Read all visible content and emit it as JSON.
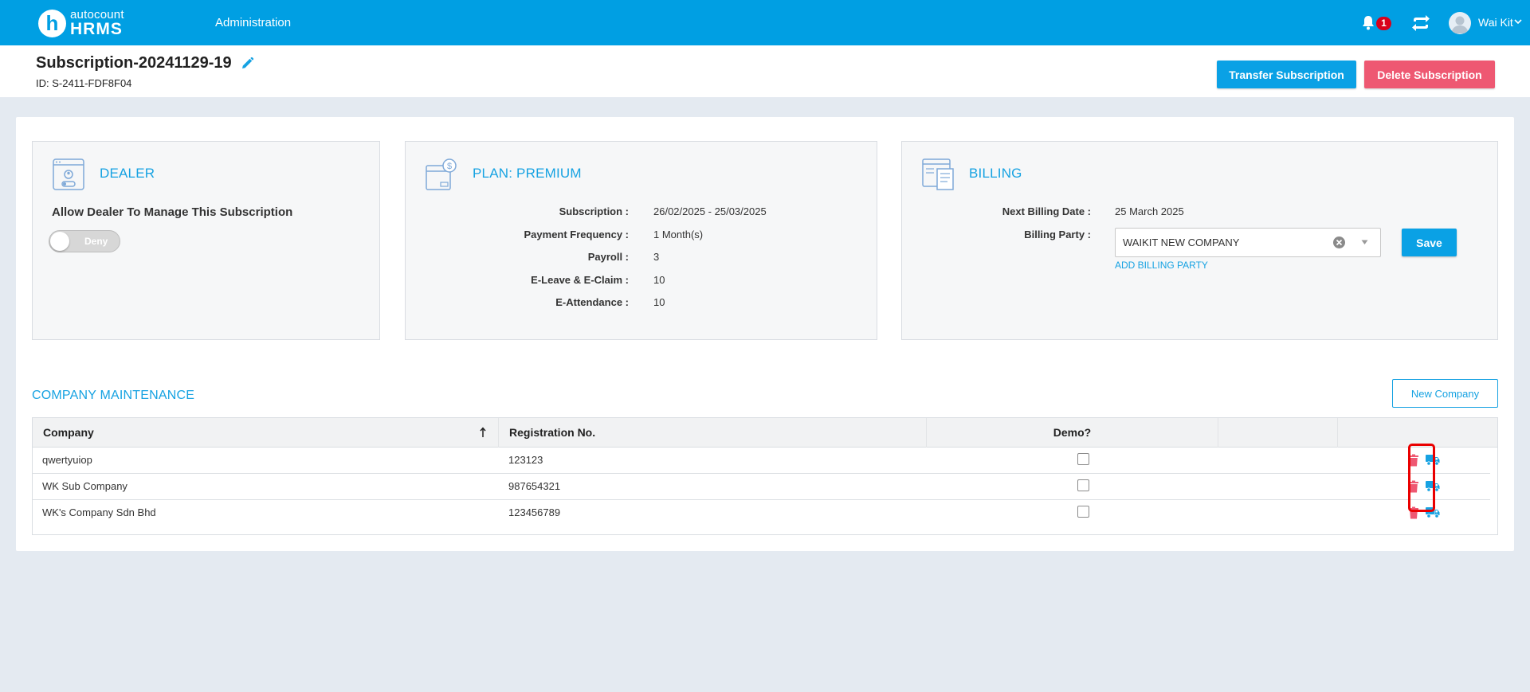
{
  "app": {
    "logo_letter": "h",
    "logo_line1": "autocount",
    "logo_line2": "HRMS"
  },
  "topnav": {
    "admin_label": "Administration",
    "notification_count": "1",
    "user_name": "Wai Kit"
  },
  "subheader": {
    "title": "Subscription-20241129-19",
    "id_text": "ID: S-2411-FDF8F04",
    "transfer_label": "Transfer Subscription",
    "delete_label": "Delete Subscription"
  },
  "dealer": {
    "title": "DEALER",
    "allow_label": "Allow Dealer To Manage This Subscription",
    "toggle_text": "Deny"
  },
  "plan": {
    "title": "PLAN: PREMIUM",
    "rows": [
      {
        "label": "Subscription :",
        "value": "26/02/2025 - 25/03/2025"
      },
      {
        "label": "Payment Frequency :",
        "value": "1 Month(s)"
      },
      {
        "label": "Payroll :",
        "value": "3"
      },
      {
        "label": "E-Leave & E-Claim :",
        "value": "10"
      },
      {
        "label": "E-Attendance :",
        "value": "10"
      }
    ]
  },
  "billing": {
    "title": "BILLING",
    "next_billing_label": "Next Billing Date :",
    "next_billing_value": "25 March 2025",
    "party_label": "Billing Party :",
    "party_value": "WAIKIT NEW COMPANY",
    "add_party_label": "ADD BILLING PARTY",
    "save_label": "Save"
  },
  "company_maintenance": {
    "title": "COMPANY MAINTENANCE",
    "new_company_label": "New Company",
    "columns": {
      "company": "Company",
      "registration": "Registration No.",
      "demo": "Demo?"
    },
    "rows": [
      {
        "company": "qwertyuiop",
        "registration": "123123",
        "demo": false
      },
      {
        "company": "WK Sub Company",
        "registration": "987654321",
        "demo": false
      },
      {
        "company": "WK's Company Sdn Bhd",
        "registration": "123456789",
        "demo": false
      }
    ]
  },
  "colors": {
    "primary": "#009fe3",
    "accent_text": "#16a2e2",
    "danger": "#ee5872",
    "highlight": "#ea0000"
  }
}
